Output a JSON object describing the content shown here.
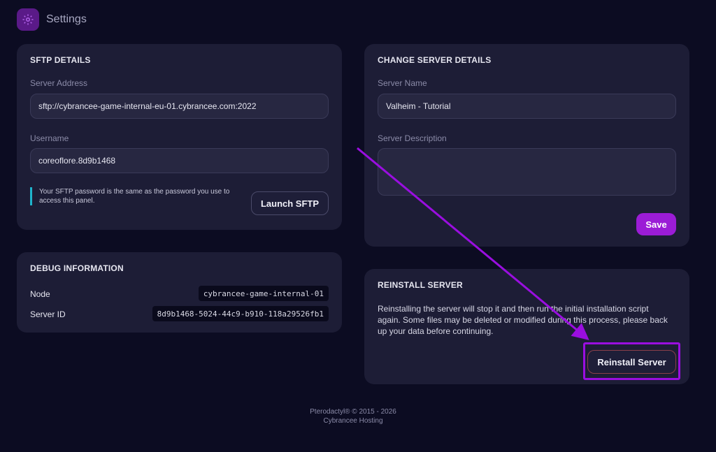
{
  "header": {
    "title": "Settings",
    "icon": "gear-icon"
  },
  "sftp": {
    "title": "SFTP DETAILS",
    "server_address_label": "Server Address",
    "server_address_value": "sftp://cybrancee-game-internal-eu-01.cybrancee.com:2022",
    "username_label": "Username",
    "username_value": "coreoflore.8d9b1468",
    "note": "Your SFTP password is the same as the password you use to access this panel.",
    "launch_button": "Launch SFTP"
  },
  "change": {
    "title": "CHANGE SERVER DETAILS",
    "server_name_label": "Server Name",
    "server_name_value": "Valheim - Tutorial",
    "server_description_label": "Server Description",
    "server_description_value": "",
    "save_button": "Save"
  },
  "debug": {
    "title": "DEBUG INFORMATION",
    "node_label": "Node",
    "node_value": "cybrancee-game-internal-01",
    "server_id_label": "Server ID",
    "server_id_value": "8d9b1468-5024-44c9-b910-118a29526fb1"
  },
  "reinstall": {
    "title": "REINSTALL SERVER",
    "description": "Reinstalling the server will stop it and then run the initial installation script again. Some files may be deleted or modified during this process, please back up your data before continuing.",
    "button": "Reinstall Server"
  },
  "footer": {
    "line1": "Pterodactyl® © 2015 - 2026",
    "line2": "Cybrancee Hosting"
  },
  "colors": {
    "accent": "#9b1cd6",
    "annotation": "#9a0ee0",
    "note_border": "#1fb4cc"
  }
}
